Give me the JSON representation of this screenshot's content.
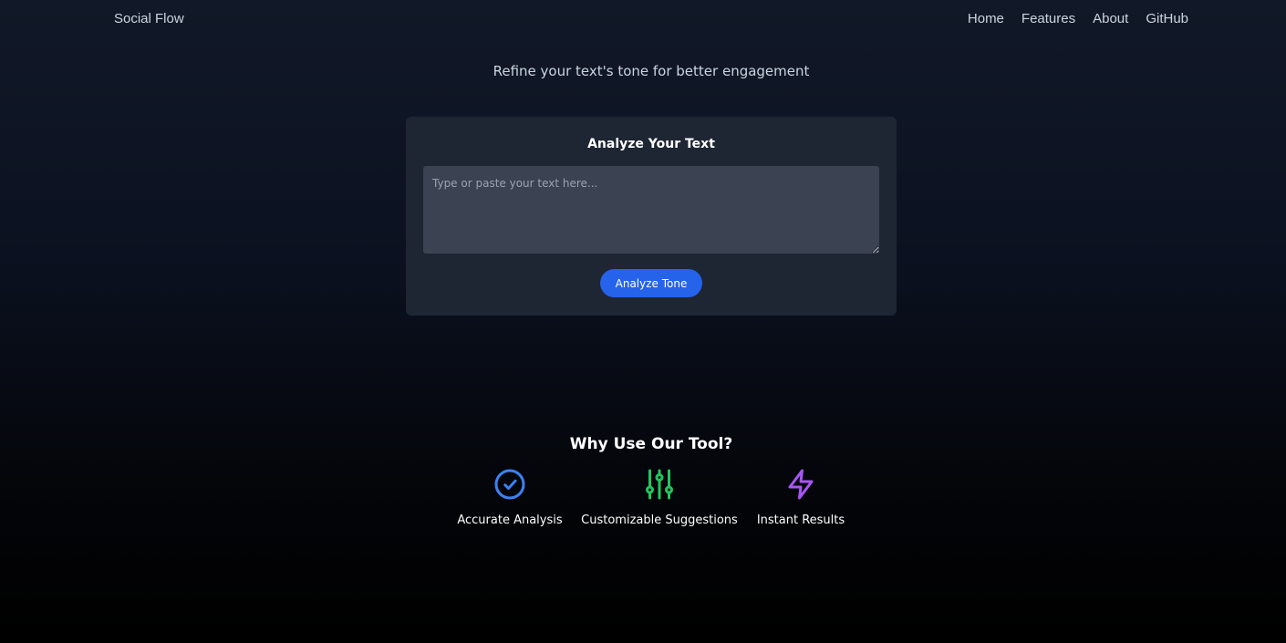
{
  "nav": {
    "brand": "Social Flow",
    "links": [
      "Home",
      "Features",
      "About",
      "GitHub"
    ]
  },
  "hero": {
    "tagline": "Refine your text's tone for better engagement"
  },
  "analyzer": {
    "title": "Analyze Your Text",
    "textarea_placeholder": "Type or paste your text here...",
    "textarea_value": "",
    "button_label": "Analyze Tone"
  },
  "features": {
    "title": "Why Use Our Tool?",
    "items": [
      {
        "label": "Accurate Analysis",
        "icon": "check-circle-icon",
        "color": "#3b82f6"
      },
      {
        "label": "Customizable Suggestions",
        "icon": "sliders-icon",
        "color": "#22c55e"
      },
      {
        "label": "Instant Results",
        "icon": "lightning-icon",
        "color": "#a855f7"
      }
    ]
  },
  "colors": {
    "accent": "#2563eb",
    "card_bg": "#1e2533",
    "textarea_bg": "#3b4352"
  }
}
